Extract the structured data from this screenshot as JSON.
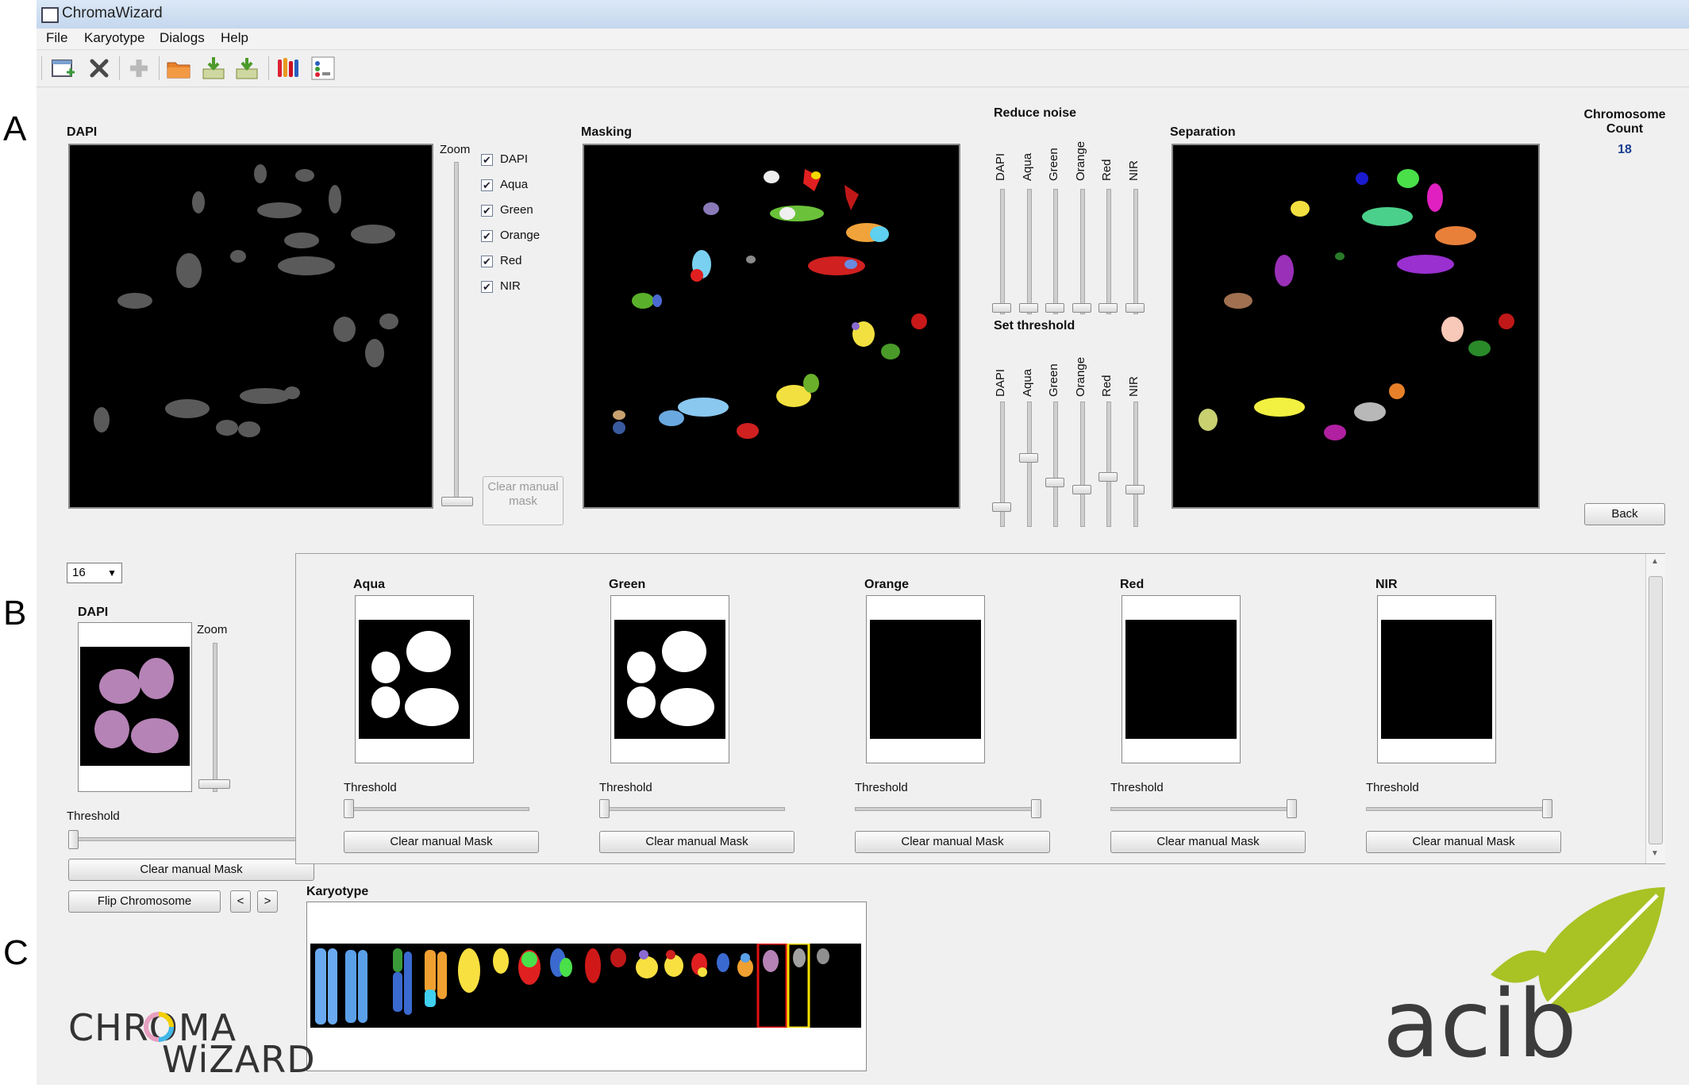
{
  "figure_labels": [
    "A",
    "B",
    "C"
  ],
  "window": {
    "title": "ChromaWizard",
    "menu": [
      "File",
      "Karyotype",
      "Dialogs",
      "Help"
    ],
    "toolbar_icons": [
      "new-image-icon",
      "close-icon",
      "add-icon",
      "open-folder-icon",
      "import-icon",
      "export-icon",
      "karyotype-icon",
      "channels-icon"
    ]
  },
  "section_a": {
    "dapi_label": "DAPI",
    "zoom_label": "Zoom",
    "channels": [
      {
        "label": "DAPI",
        "checked": true
      },
      {
        "label": "Aqua",
        "checked": true
      },
      {
        "label": "Green",
        "checked": true
      },
      {
        "label": "Orange",
        "checked": true
      },
      {
        "label": "Red",
        "checked": true
      },
      {
        "label": "NIR",
        "checked": true
      }
    ],
    "clear_mask_button": "Clear manual mask",
    "masking_label": "Masking",
    "reduce_noise_label": "Reduce noise",
    "set_threshold_label": "Set threshold",
    "slider_channels": [
      "DAPI",
      "Aqua",
      "Green",
      "Orange",
      "Red",
      "NIR"
    ],
    "reduce_noise_levels": [
      0,
      0,
      0,
      0,
      0,
      0
    ],
    "threshold_levels": [
      0.12,
      0.55,
      0.33,
      0.27,
      0.38,
      0.27
    ],
    "separation_label": "Separation",
    "chromosome_count_label": "Chromosome Count",
    "chromosome_count": "18",
    "back_button": "Back"
  },
  "section_b": {
    "chromosome_select": "16",
    "dapi_label": "DAPI",
    "zoom_label": "Zoom",
    "threshold_label": "Threshold",
    "clear_manual_mask": "Clear manual Mask",
    "flip_button": "Flip Chromosome",
    "prev_button": "<",
    "next_button": ">",
    "channels": [
      {
        "name": "Aqua",
        "threshold_label": "Threshold",
        "threshold_level": 0,
        "button": "Clear manual Mask"
      },
      {
        "name": "Green",
        "threshold_label": "Threshold",
        "threshold_level": 0,
        "button": "Clear manual Mask"
      },
      {
        "name": "Orange",
        "threshold_label": "Threshold",
        "threshold_level": 1,
        "button": "Clear manual Mask"
      },
      {
        "name": "Red",
        "threshold_label": "Threshold",
        "threshold_level": 1,
        "button": "Clear manual Mask"
      },
      {
        "name": "NIR",
        "threshold_label": "Threshold",
        "threshold_level": 1,
        "button": "Clear manual Mask"
      }
    ]
  },
  "section_c": {
    "karyotype_label": "Karyotype",
    "logo_text_top": "CHROMA",
    "logo_text_bottom": "WiZARD",
    "partner_logo": "acib"
  },
  "colors": {
    "window_bg": "#f0f0f0",
    "accent_count": "#1a3f8f",
    "logo_green": "#a9c224",
    "highlight_red": "#e01010",
    "highlight_yellow": "#f5e000"
  }
}
